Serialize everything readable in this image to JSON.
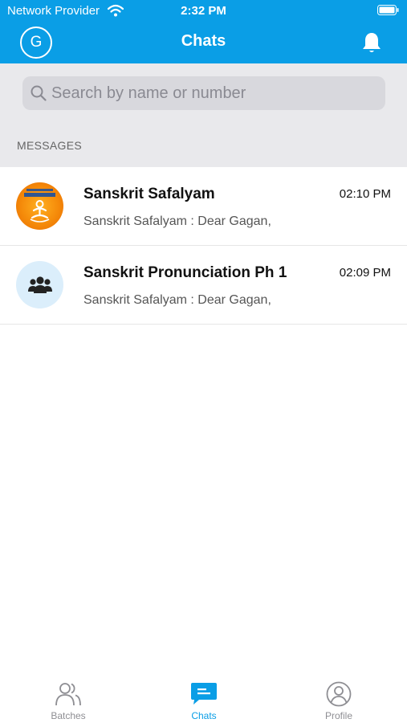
{
  "status_bar": {
    "carrier": "Network Provider",
    "time": "2:32 PM"
  },
  "header": {
    "title": "Chats",
    "avatar_initial": "G"
  },
  "search": {
    "placeholder": "Search by name or number"
  },
  "section_label": "MESSAGES",
  "chats": [
    {
      "name": "Sanskrit Safalyam",
      "time": "02:10 PM",
      "preview": "Sanskrit Safalyam : Dear Gagan,",
      "avatar": "logo-avatar"
    },
    {
      "name": "Sanskrit Pronunciation Ph 1",
      "time": "02:09 PM",
      "preview": "Sanskrit Safalyam : Dear Gagan,",
      "avatar": "group-icon"
    }
  ],
  "tabs": [
    {
      "label": "Batches",
      "icon": "batches-icon",
      "active": false
    },
    {
      "label": "Chats",
      "icon": "chats-icon",
      "active": true
    },
    {
      "label": "Profile",
      "icon": "profile-icon",
      "active": false
    }
  ],
  "colors": {
    "primary": "#0a9ee6",
    "search_bg": "#e9e9ec",
    "inactive_tab": "#8e8e93"
  }
}
